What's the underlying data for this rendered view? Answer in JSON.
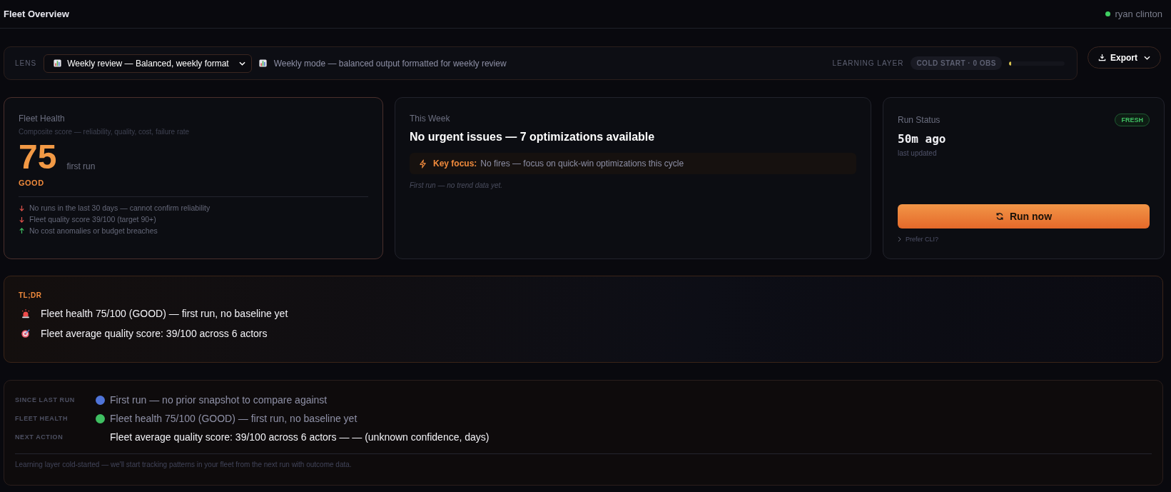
{
  "header": {
    "title": "Fleet Overview",
    "user": {
      "name": "ryan clinton",
      "online": true
    }
  },
  "lens": {
    "label": "LENS",
    "select": "Weekly review — Balanced, weekly format",
    "description": "Weekly mode — balanced output formatted for weekly review",
    "learning_label": "LEARNING LAYER",
    "learning_badge": "COLD START · 0 OBS",
    "level": 0.03
  },
  "export_button": "Export",
  "fleet_health": {
    "title": "Fleet Health",
    "subtitle": "Composite score — reliability, quality, cost, failure rate",
    "score": "75",
    "score_note": "first run",
    "grade": "GOOD",
    "reasons": [
      {
        "kind": "down",
        "text": "No runs in the last 30 days — cannot confirm reliability"
      },
      {
        "kind": "down",
        "text": "Fleet quality score 39/100 (target 90+)"
      },
      {
        "kind": "up",
        "text": "No cost anomalies or budget breaches"
      }
    ]
  },
  "this_week": {
    "label": "This Week",
    "headline": "No urgent issues — 7 optimizations available",
    "focus_label": "Key focus:",
    "focus_text": "No fires — focus on quick-win optimizations this cycle",
    "trend_note": "First run — no trend data yet."
  },
  "run_status": {
    "title": "Run Status",
    "badge": "FRESH",
    "age": "50m ago",
    "age_label": "last updated",
    "button": "Run now",
    "cli_link": "Prefer CLI?"
  },
  "tldr": {
    "label": "TL;DR",
    "items": [
      {
        "kind": "alert",
        "text": "Fleet health 75/100 (GOOD) — first run, no baseline yet"
      },
      {
        "kind": "target",
        "text": "Fleet average quality score: 39/100 across 6 actors"
      }
    ]
  },
  "summary": {
    "rows": [
      {
        "label": "SINCE LAST RUN",
        "color": "#4f74d8",
        "text": "First run — no prior snapshot to compare against"
      },
      {
        "label": "FLEET HEALTH",
        "color": "#3fbf62",
        "text": "Fleet health 75/100 (GOOD) — first run, no baseline yet"
      },
      {
        "label": "NEXT ACTION",
        "text": "Fleet average quality score: 39/100 across 6 actors — — (unknown confidence, days)"
      }
    ],
    "footnote": "Learning layer cold-started — we'll start tracking patterns in your fleet from the next run with outcome data."
  }
}
